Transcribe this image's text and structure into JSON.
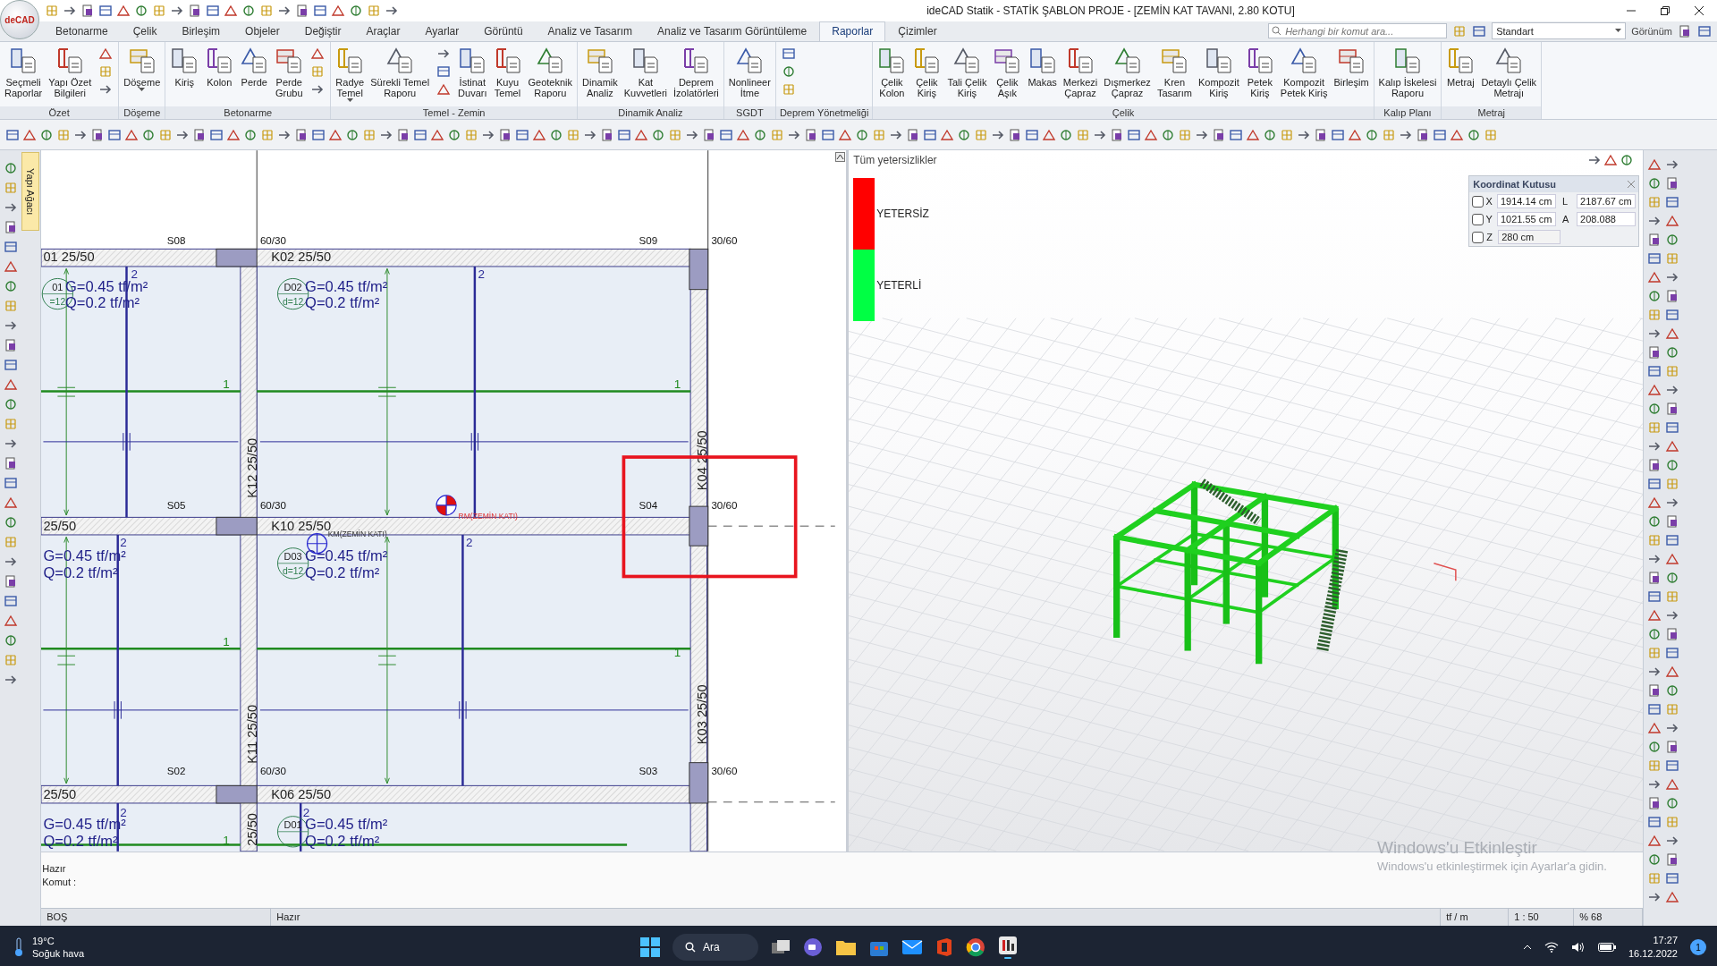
{
  "app": {
    "logo": "deCAD",
    "title": "ideCAD Statik - STATİK ŞABLON PROJE - [ZEMİN KAT TAVANI,  2.80 KOTU]"
  },
  "tabs": [
    {
      "label": "Betonarme",
      "selected": false
    },
    {
      "label": "Çelik",
      "selected": false
    },
    {
      "label": "Birleşim",
      "selected": false
    },
    {
      "label": "Objeler",
      "selected": false
    },
    {
      "label": "Değiştir",
      "selected": false
    },
    {
      "label": "Araçlar",
      "selected": false
    },
    {
      "label": "Ayarlar",
      "selected": false
    },
    {
      "label": "Görüntü",
      "selected": false
    },
    {
      "label": "Analiz ve Tasarım",
      "selected": false
    },
    {
      "label": "Analiz ve Tasarım Görüntüleme",
      "selected": false
    },
    {
      "label": "Raporlar",
      "selected": true
    },
    {
      "label": "Çizimler",
      "selected": false
    }
  ],
  "search": {
    "placeholder": "Herhangi bir komut ara..."
  },
  "style_dropdown": {
    "value": "Standart"
  },
  "view_menu": {
    "label": "Görünüm"
  },
  "ribbon": [
    {
      "label": "Özet",
      "items": [
        {
          "kind": "large",
          "label": "Seçmeli\nRaporlar"
        },
        {
          "kind": "large",
          "label": "Yapı Özet\nBilgileri"
        },
        {
          "kind": "stack"
        }
      ]
    },
    {
      "label": "Döşeme",
      "items": [
        {
          "kind": "split",
          "label": "Döşeme"
        }
      ]
    },
    {
      "label": "Betonarme",
      "items": [
        {
          "kind": "large",
          "label": "Kiriş"
        },
        {
          "kind": "large",
          "label": "Kolon"
        },
        {
          "kind": "large",
          "label": "Perde"
        },
        {
          "kind": "large",
          "label": "Perde\nGrubu"
        },
        {
          "kind": "stack"
        }
      ]
    },
    {
      "label": "Temel - Zemin",
      "items": [
        {
          "kind": "split",
          "label": "Radye\nTemel"
        },
        {
          "kind": "large",
          "label": "Sürekli Temel\nRaporu"
        },
        {
          "kind": "stack"
        },
        {
          "kind": "large",
          "label": "İstinat\nDuvarı"
        },
        {
          "kind": "large",
          "label": "Kuyu\nTemel"
        },
        {
          "kind": "large",
          "label": "Geoteknik\nRaporu"
        }
      ]
    },
    {
      "label": "Dinamik Analiz",
      "items": [
        {
          "kind": "large",
          "label": "Dinamik\nAnaliz"
        },
        {
          "kind": "large",
          "label": "Kat\nKuvvetleri"
        },
        {
          "kind": "large",
          "label": "Deprem\nİzolatörleri"
        }
      ]
    },
    {
      "label": "SGDT",
      "items": [
        {
          "kind": "large",
          "label": "Nonlineer\nİtme"
        }
      ]
    },
    {
      "label": "Deprem Yönetmeliği",
      "items": [
        {
          "kind": "stack"
        }
      ]
    },
    {
      "label": "Çelik",
      "items": [
        {
          "kind": "large",
          "label": "Çelik\nKolon"
        },
        {
          "kind": "large",
          "label": "Çelik\nKiriş"
        },
        {
          "kind": "large",
          "label": "Tali Çelik\nKiriş"
        },
        {
          "kind": "large",
          "label": "Çelik\nAşık"
        },
        {
          "kind": "large",
          "label": "Makas"
        },
        {
          "kind": "large",
          "label": "Merkezi\nÇapraz"
        },
        {
          "kind": "large",
          "label": "Dışmerkez\nÇapraz"
        },
        {
          "kind": "large",
          "label": "Kren\nTasarım"
        },
        {
          "kind": "large",
          "label": "Kompozit\nKiriş"
        },
        {
          "kind": "large",
          "label": "Petek\nKiriş"
        },
        {
          "kind": "large",
          "label": "Kompozit\nPetek Kiriş"
        },
        {
          "kind": "large",
          "label": "Birleşim"
        }
      ]
    },
    {
      "label": "Kalıp Planı",
      "items": [
        {
          "kind": "large",
          "label": "Kalıp İskelesi\nRaporu"
        }
      ]
    },
    {
      "label": "Metraj",
      "items": [
        {
          "kind": "large",
          "label": "Metraj"
        },
        {
          "kind": "large",
          "label": "Detaylı Çelik\nMetrajı"
        }
      ]
    }
  ],
  "side_tab": "Yapı Ağacı",
  "plan": {
    "column_labels": [
      "S08",
      "S09",
      "S05",
      "S04",
      "S02",
      "S03"
    ],
    "column_sizes": [
      "60/30",
      "30/60",
      "60/30",
      "30/60",
      "60/30",
      "30/60"
    ],
    "beam_labels": [
      "01 25/50",
      "K02 25/50",
      "25/50",
      "K10 25/50",
      "25/50",
      "K06 25/50"
    ],
    "vertical_beam_labels": [
      "K12 25/50",
      "K11 25/50",
      "25/50",
      "K04 25/50",
      "K03 25/50"
    ],
    "slabs": [
      {
        "name": "01",
        "thickness": "=12",
        "dead_load": "G=0.45 tf/m²",
        "live_load": "Q=0.2 tf/m²"
      },
      {
        "name": "D02",
        "thickness": "d=12",
        "dead_load": "G=0.45 tf/m²",
        "live_load": "Q=0.2 tf/m²"
      },
      {
        "dead_load": "G=0.45 tf/m²",
        "live_load": "Q=0.2 tf/m²"
      },
      {
        "name": "D03",
        "thickness": "d=12",
        "dead_load": "G=0.45 tf/m²",
        "live_load": "Q=0.2 tf/m²"
      },
      {
        "dead_load": "G=0.45 tf/m²",
        "live_load": "Q=0.2 tf/m²"
      },
      {
        "name": "D01",
        "dead_load": "G=0.45 tf/m²",
        "live_load": "Q=0.2 tf/m²"
      }
    ],
    "rebar_marks": [
      "2",
      "2",
      "2",
      "2",
      "2",
      "2",
      "1",
      "1",
      "1",
      "1",
      "1"
    ],
    "markers": [
      "RM(ZEMİN KATI)",
      "KM(ZEMİN KATI)"
    ]
  },
  "results_view": {
    "title": "Tüm yetersizlikler",
    "legend": [
      {
        "label": "YETERSİZ",
        "color": "#ff0000"
      },
      {
        "label": "YETERLİ",
        "color": "#00ff44"
      }
    ]
  },
  "coordinate_box": {
    "title": "Koordinat Kutusu",
    "fields": [
      {
        "axis": "X",
        "checked": false,
        "value": "1914.14 cm",
        "extra_label": "L",
        "extra_value": "2187.67 cm"
      },
      {
        "axis": "Y",
        "checked": false,
        "value": "1021.55 cm",
        "extra_label": "A",
        "extra_value": "208.088"
      },
      {
        "axis": "Z",
        "checked": false,
        "value": "280 cm"
      }
    ]
  },
  "command": {
    "status": "Hazır",
    "prompt": "Komut :"
  },
  "status_bar": [
    "BOŞ",
    "Hazır",
    "tf / m",
    "1 : 50",
    "% 68"
  ],
  "activation": {
    "title": "Windows'u Etkinleştir",
    "message": "Windows'u etkinleştirmek için Ayarlar'a gidin."
  },
  "taskbar": {
    "temperature": "19°C",
    "weather": "Soğuk hava",
    "search": "Ara",
    "time": "17:27",
    "date": "16.12.2022",
    "notifications": "1"
  }
}
